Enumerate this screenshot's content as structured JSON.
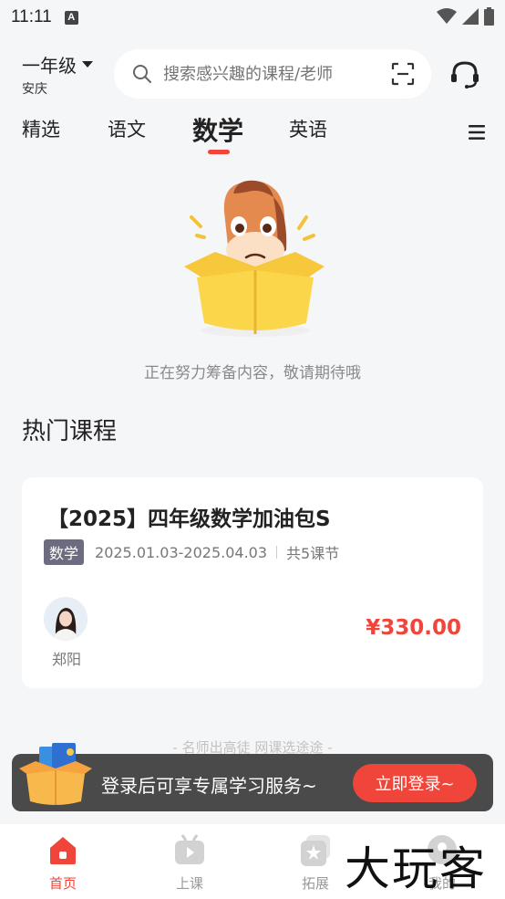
{
  "status_bar": {
    "time": "11:11",
    "notification_letter": "A"
  },
  "header": {
    "grade": "一年级",
    "city": "安庆",
    "search_placeholder": "搜索感兴趣的课程/老师"
  },
  "tabs": [
    {
      "label": "精选"
    },
    {
      "label": "语文"
    },
    {
      "label": "数学",
      "active": true
    },
    {
      "label": "英语"
    }
  ],
  "empty_state": {
    "message": "正在努力筹备内容，敬请期待哦"
  },
  "hot_courses": {
    "title": "热门课程",
    "courses": [
      {
        "title": "【2025】四年级数学加油包S",
        "subject": "数学",
        "dates": "2025.01.03-2025.04.03",
        "lessons": "共5课节",
        "teacher": "郑阳",
        "price": "¥330.00"
      }
    ]
  },
  "slogan": "- 名师出高徒 网课选途途 -",
  "login_bar": {
    "text": "登录后可享专属学习服务~",
    "button": "立即登录~"
  },
  "bottom_nav": [
    {
      "label": "首页",
      "icon": "home-icon",
      "active": true
    },
    {
      "label": "上课",
      "icon": "class-tv-icon"
    },
    {
      "label": "拓展",
      "icon": "extend-star-icon"
    },
    {
      "label": "我的",
      "icon": "profile-icon"
    }
  ],
  "watermark": "大玩客",
  "colors": {
    "accent": "#f0453a",
    "badge": "#6c6c80",
    "background": "#f5f6f8"
  }
}
